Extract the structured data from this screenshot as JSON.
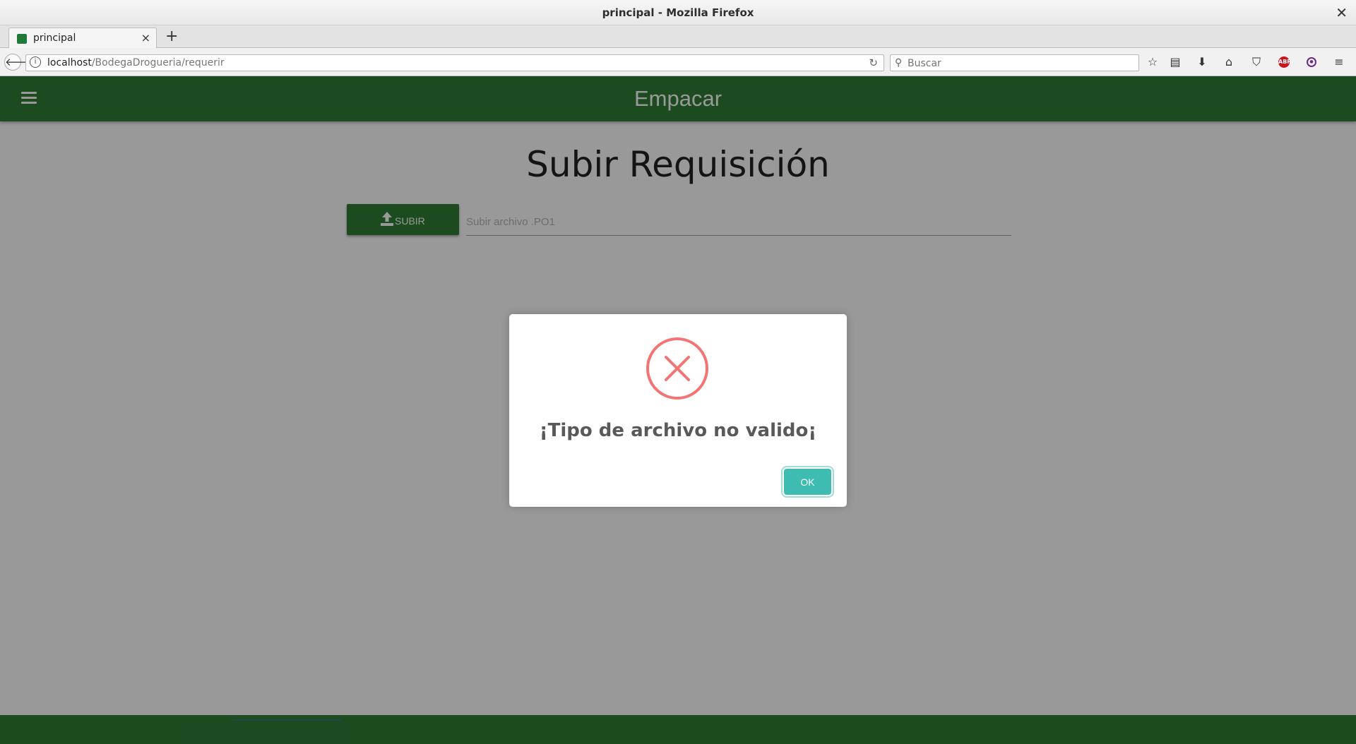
{
  "window": {
    "title": "principal - Mozilla Firefox",
    "close_glyph": "✕"
  },
  "tabs": [
    {
      "label": "principal",
      "close_glyph": "×"
    }
  ],
  "new_tab_glyph": "+",
  "nav": {
    "url_host": "localhost",
    "url_path": "/BodegaDrogueria/requerir",
    "search_placeholder": "Buscar",
    "icons": [
      "back-icon",
      "info-icon",
      "reload-icon",
      "search-icon",
      "bookmark-star-icon",
      "reader-view-icon",
      "downloads-icon",
      "home-icon",
      "pocket-icon",
      "adblock-plus-icon",
      "tor-extension-icon",
      "menu-icon"
    ]
  },
  "app": {
    "title": "Empacar",
    "heading": "Subir Requisición",
    "upload_button_label": "SUBIR",
    "file_placeholder": "Subir archivo .PO1"
  },
  "dialog": {
    "icon": "error-x-icon",
    "message": "¡Tipo de archivo no valido¡",
    "ok_label": "OK"
  },
  "colors": {
    "app_green": "#2e7d32",
    "error_red": "#f27474",
    "ok_teal": "#3fbcb2"
  }
}
